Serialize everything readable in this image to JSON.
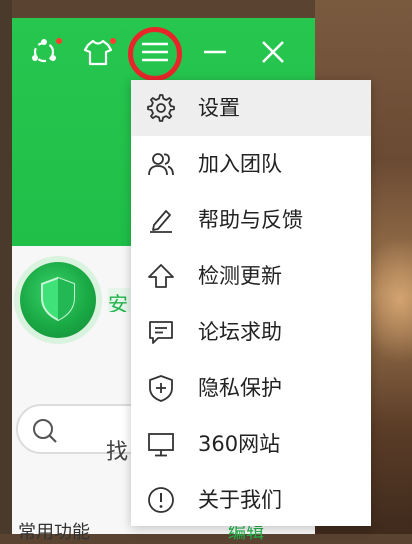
{
  "menu": {
    "items": [
      {
        "label": "设置",
        "icon": "gear-icon"
      },
      {
        "label": "加入团队",
        "icon": "people-icon"
      },
      {
        "label": "帮助与反馈",
        "icon": "pencil-icon"
      },
      {
        "label": "检测更新",
        "icon": "arrow-up-icon"
      },
      {
        "label": "论坛求助",
        "icon": "chat-icon"
      },
      {
        "label": "隐私保护",
        "icon": "shield-plus-icon"
      },
      {
        "label": "360网站",
        "icon": "monitor-icon"
      },
      {
        "label": "关于我们",
        "icon": "info-icon"
      }
    ]
  },
  "partial": {
    "status_char": "安",
    "search_char": "找",
    "bottom_left": "常用功能",
    "bottom_right": "编辑"
  },
  "colors": {
    "header_green": "#22c24c",
    "highlight_red": "#e8262a",
    "badge_red": "#ff3b30"
  }
}
